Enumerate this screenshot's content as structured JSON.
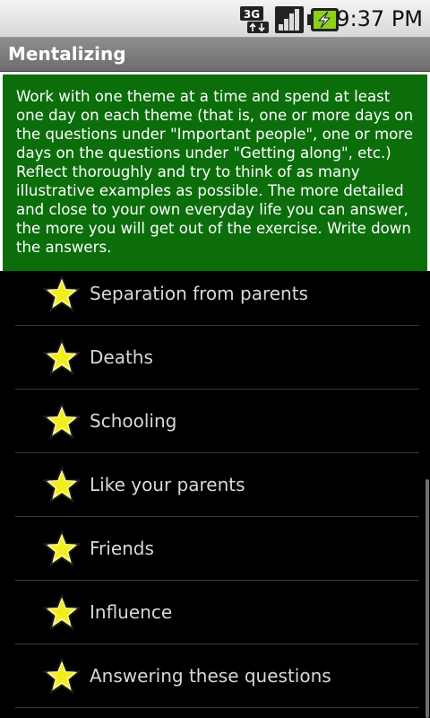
{
  "status_bar": {
    "network_type": "3G",
    "time": "9:37 PM",
    "icons": [
      "3g-data-icon",
      "signal-strength-icon",
      "battery-charging-icon"
    ]
  },
  "app": {
    "title": "Mentalizing"
  },
  "intro": {
    "text": "Work with one theme at a time and spend at least one day on each theme (that is, one or more days on the questions under \"Important people\", one or more days on the questions under \"Getting along\", etc.) Reflect thoroughly and try to think of as many illustrative examples as possible. The more detailed and close to your own everyday life you can answer, the more you will get out of the exercise. Write down the answers."
  },
  "list": {
    "items": [
      {
        "label": "Separation from parents",
        "icon": "star-icon"
      },
      {
        "label": "Deaths",
        "icon": "star-icon"
      },
      {
        "label": "Schooling",
        "icon": "star-icon"
      },
      {
        "label": "Like your parents",
        "icon": "star-icon"
      },
      {
        "label": "Friends",
        "icon": "star-icon"
      },
      {
        "label": "Influence",
        "icon": "star-icon"
      },
      {
        "label": "Answering these questions",
        "icon": "star-icon"
      }
    ]
  },
  "colors": {
    "intro_background": "#0b6e0b",
    "star_fill": "#f2ee1e",
    "list_background": "#000000",
    "list_text": "#d8d8d8"
  }
}
